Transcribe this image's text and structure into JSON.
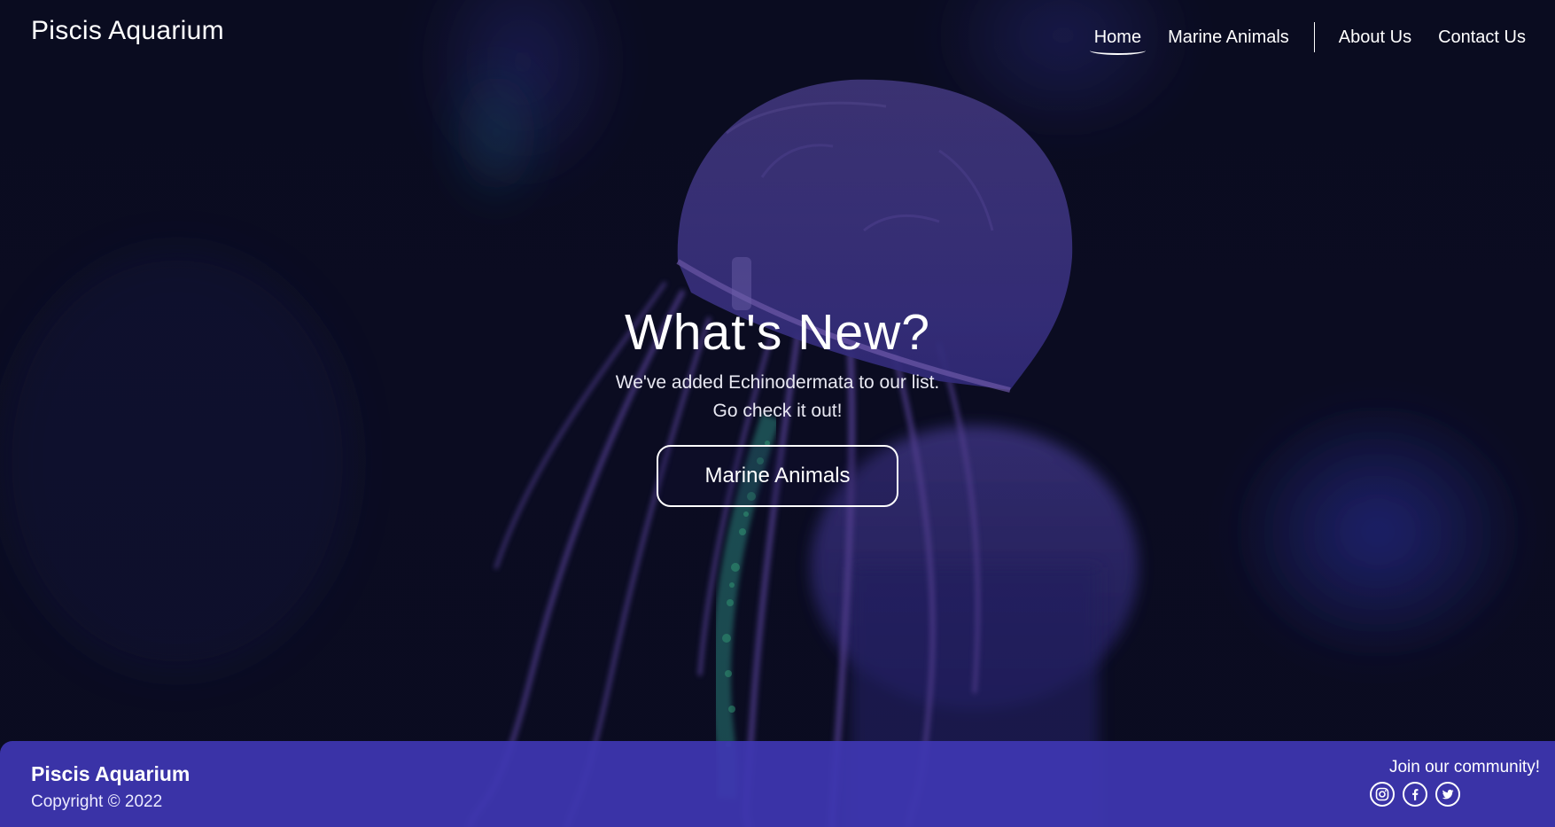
{
  "header": {
    "brand": "Piscis Aquarium",
    "nav": {
      "home": "Home",
      "marine_animals": "Marine Animals",
      "about": "About Us",
      "contact": "Contact Us"
    },
    "active": "Home"
  },
  "hero": {
    "title": "What's New?",
    "line1": "We've added Echinodermata to our list.",
    "line2": "Go check it out!",
    "button": "Marine Animals"
  },
  "footer": {
    "brand": "Piscis Aquarium",
    "copyright": "Copyright © 2022",
    "community": "Join our community!",
    "social": [
      "instagram-icon",
      "facebook-icon",
      "twitter-icon"
    ]
  },
  "colors": {
    "background": "#0b0d22",
    "footer": "#3e37b2",
    "text": "#ffffff"
  }
}
